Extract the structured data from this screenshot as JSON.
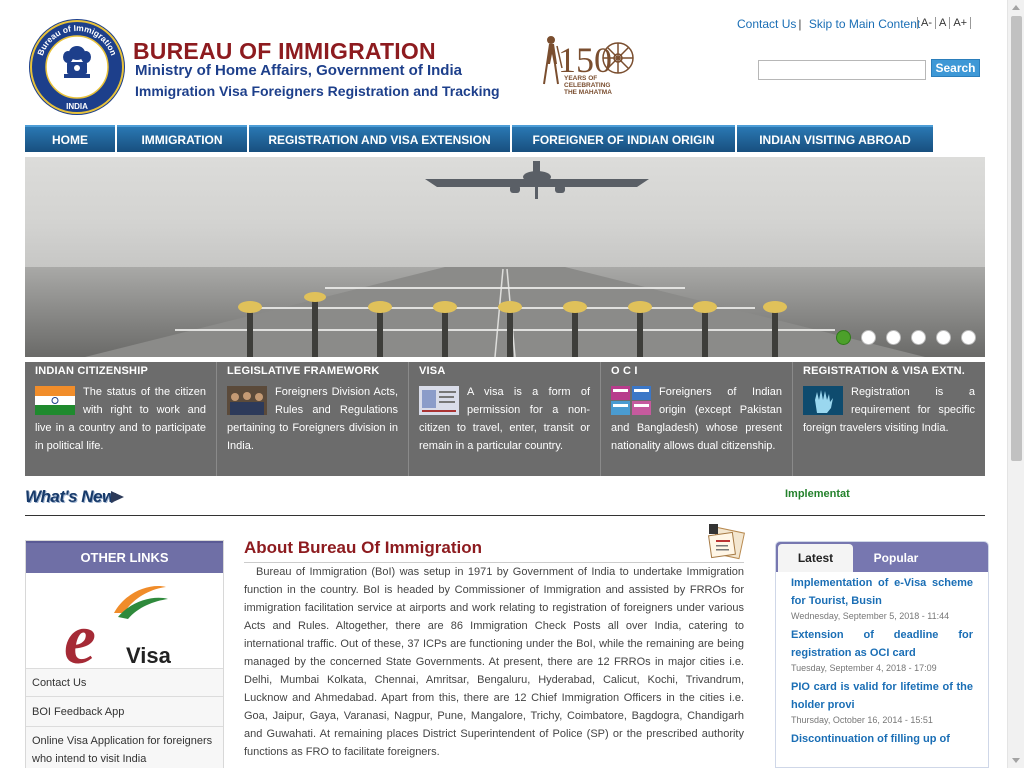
{
  "header": {
    "title": "BUREAU OF IMMIGRATION",
    "subtitle1": "Ministry of Home Affairs, Government of India",
    "subtitle2": "Immigration Visa Foreigners Registration and Tracking",
    "logo_text": "Bureau of Immigration",
    "logo_bottom": "INDIA",
    "mahatma_number": "150",
    "mahatma_text1": "YEARS OF",
    "mahatma_text2": "CELEBRATING",
    "mahatma_text3": "THE MAHATMA"
  },
  "toplinks": {
    "contact": "Contact Us",
    "skip": "Skip to Main Content",
    "font_small": "A-",
    "font_normal": "A",
    "font_large": "A+"
  },
  "search": {
    "placeholder": "",
    "button": "Search"
  },
  "nav": {
    "items": [
      {
        "label": "HOME"
      },
      {
        "label": "IMMIGRATION"
      },
      {
        "label": "REGISTRATION AND VISA EXTENSION"
      },
      {
        "label": "FOREIGNER OF INDIAN ORIGIN"
      },
      {
        "label": "INDIAN VISITING ABROAD"
      }
    ]
  },
  "slider": {
    "slides": 6,
    "active": 1
  },
  "features": [
    {
      "title": "INDIAN CITIZENSHIP",
      "text": "The status of the citizen with right to work and live in a country and to participate in political life.",
      "icon": "india-flag-icon"
    },
    {
      "title": "LEGISLATIVE FRAMEWORK",
      "text": "Foreigners Division Acts, Rules and Regulations pertaining to Foreigners division in India.",
      "icon": "group-photo-icon"
    },
    {
      "title": "VISA",
      "text": "A visa is a form of permission for a non-citizen to travel, enter, transit or remain in a particular country.",
      "icon": "visa-document-icon"
    },
    {
      "title": "O C I",
      "text": "Foreigners of Indian origin (except Pakistan and Bangladesh) whose present nationality allows dual citizenship.",
      "icon": "oci-cards-icon"
    },
    {
      "title": "REGISTRATION & VISA EXTN.",
      "text": "Registration is a requirement for specific foreign travelers visiting India.",
      "icon": "hand-scan-icon"
    }
  ],
  "whats_new": {
    "label": "What's New",
    "ticker": "Implementat"
  },
  "other_links": {
    "title": "OTHER LINKS",
    "evisa_letter": "e",
    "evisa_word": "Visa",
    "items": [
      "Contact Us",
      "BOI Feedback App",
      "Online Visa Application for foreigners who intend to visit India"
    ]
  },
  "about": {
    "title": "About Bureau Of Immigration",
    "text": "Bureau of Immigration (BoI) was setup in 1971 by Government of India to undertake Immigration function in the country. BoI is headed by Commissioner of Immigration and assisted by FRROs for immigration facilitation service at airports and work relating to registration of foreigners under various Acts and Rules. Altogether, there are 86 Immigration Check Posts all over India, catering to international traffic. Out of these, 37 ICPs are functioning under the BoI, while the remaining are being managed by the concerned State Governments.  At present, there are 12 FRROs in major cities i.e. Delhi, Mumbai Kolkata, Chennai, Amritsar, Bengaluru, Hyderabad, Calicut, Kochi, Trivandrum, Lucknow and Ahmedabad. Apart from this, there are 12 Chief Immigration Officers in the cities i.e. Goa, Jaipur, Gaya, Varanasi, Nagpur, Pune, Mangalore, Trichy, Coimbatore, Bagdogra, Chandigarh and Guwahati. At remaining places District Superintendent of Police (SP) or the prescribed authority functions as FRO to facilitate foreigners."
  },
  "news_tabs": {
    "latest": "Latest",
    "popular": "Popular",
    "items": [
      {
        "title": "Implementation of e-Visa scheme for Tourist, Busin",
        "date": "Wednesday, September 5, 2018 - 11:44"
      },
      {
        "title": "Extension of deadline for registration as OCI card",
        "date": "Tuesday, September 4, 2018 - 17:09"
      },
      {
        "title": "PIO card is valid for lifetime of the holder provi",
        "date": "Thursday, October 16, 2014 - 15:51"
      },
      {
        "title": "Discontinuation of filling up of",
        "date": ""
      }
    ]
  },
  "colors": {
    "brand_red": "#8d1b1f",
    "brand_blue": "#1d3f8b",
    "nav_blue": "#1c5f95",
    "panel_grey": "#6c6c6c",
    "panel_purple": "#6f6fa6",
    "link_blue": "#1a6eb5",
    "active_dot": "#4ca02a"
  }
}
